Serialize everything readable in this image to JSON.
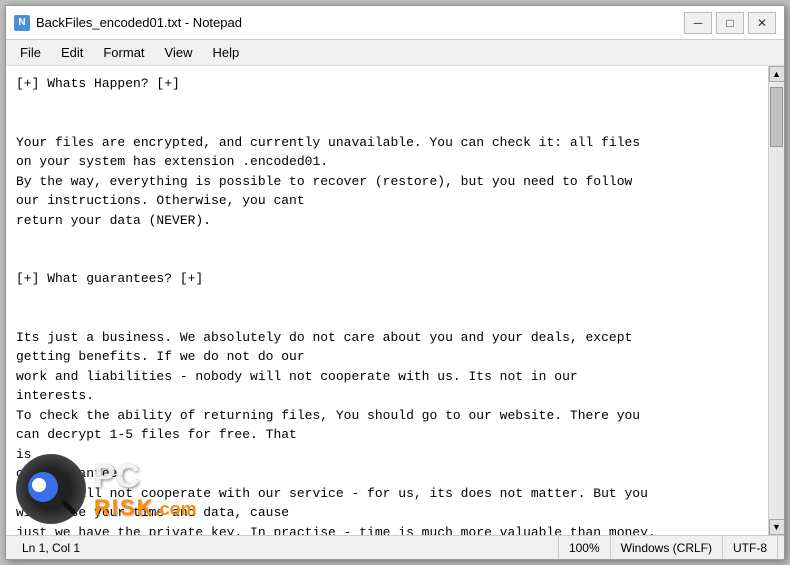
{
  "window": {
    "title": "BackFiles_encoded01.txt - Notepad",
    "icon_label": "N"
  },
  "title_buttons": {
    "minimize": "─",
    "maximize": "□",
    "close": "✕"
  },
  "menu": {
    "items": [
      "File",
      "Edit",
      "Format",
      "View",
      "Help"
    ]
  },
  "content": {
    "text": "[+] Whats Happen? [+]\n\n\nYour files are encrypted, and currently unavailable. You can check it: all files\non your system has extension .encoded01.\nBy the way, everything is possible to recover (restore), but you need to follow\nour instructions. Otherwise, you cant\nreturn your data (NEVER).\n\n\n[+] What guarantees? [+]\n\n\nIts just a business. We absolutely do not care about you and your deals, except\ngetting benefits. If we do not do our\nwork and liabilities - nobody will not cooperate with us. Its not in our\ninterests.\nTo check the ability of returning files, You should go to our website. There you\ncan decrypt 1-5 files for free. That\nis\nour guarantee.\nIf you will not cooperate with our service - for us, its does not matter. But you\nwill lose your time and data, cause\njust we have the private key. In practise - time is much more valuable than money.\n\n\n[+] How to get access on website? [+]"
  },
  "status_bar": {
    "position": "Ln 1, Col 1",
    "zoom": "100%",
    "line_ending": "Windows (CRLF)",
    "encoding": "UTF-8"
  },
  "watermark": {
    "pc_text": "PC",
    "risk_text": "RISK",
    "com_text": ".com"
  }
}
